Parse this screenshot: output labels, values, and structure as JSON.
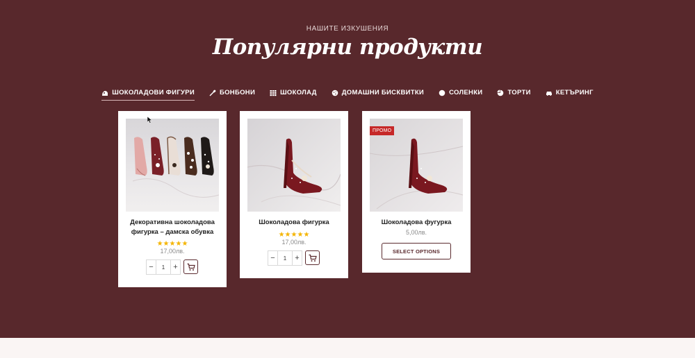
{
  "section": {
    "eyebrow": "НАШИТЕ ИЗКУШЕНИЯ",
    "title": "Популярни продукти"
  },
  "tabs": [
    {
      "label": "ШОКОЛАДОВИ ФИГУРИ",
      "icon": "figure-icon",
      "active": true
    },
    {
      "label": "БОНБОНИ",
      "icon": "spoon-icon"
    },
    {
      "label": "ШОКОЛАД",
      "icon": "grid-icon"
    },
    {
      "label": "ДОМАШНИ БИСКВИТКИ",
      "icon": "cookie-icon"
    },
    {
      "label": "СОЛЕНКИ",
      "icon": "circle-icon"
    },
    {
      "label": "ТОРТИ",
      "icon": "pie-icon"
    },
    {
      "label": "КЕТЪРИНГ",
      "icon": "car-icon"
    }
  ],
  "products": [
    {
      "name": "Декоративна шоколадова фигурка – дамска обувка",
      "stars": "★★★★★",
      "rating": 5,
      "price": "17,00лв.",
      "qty": "1",
      "qty_minus": "−",
      "qty_plus": "+"
    },
    {
      "name": "Шоколадова фигурка",
      "stars": "★★★★★",
      "rating": 5,
      "price": "17,00лв.",
      "qty": "1",
      "qty_minus": "−",
      "qty_plus": "+"
    },
    {
      "name": "Шоколадова фугурка",
      "badge": "ПРОМО",
      "price": "5,00лв.",
      "button": "SELECT OPTIONS"
    }
  ],
  "colors": {
    "hero_bg": "#58282c",
    "accent": "#5a2a2e",
    "star": "#f4b400",
    "badge": "#c62828",
    "footer_bg": "#faf5f4"
  }
}
